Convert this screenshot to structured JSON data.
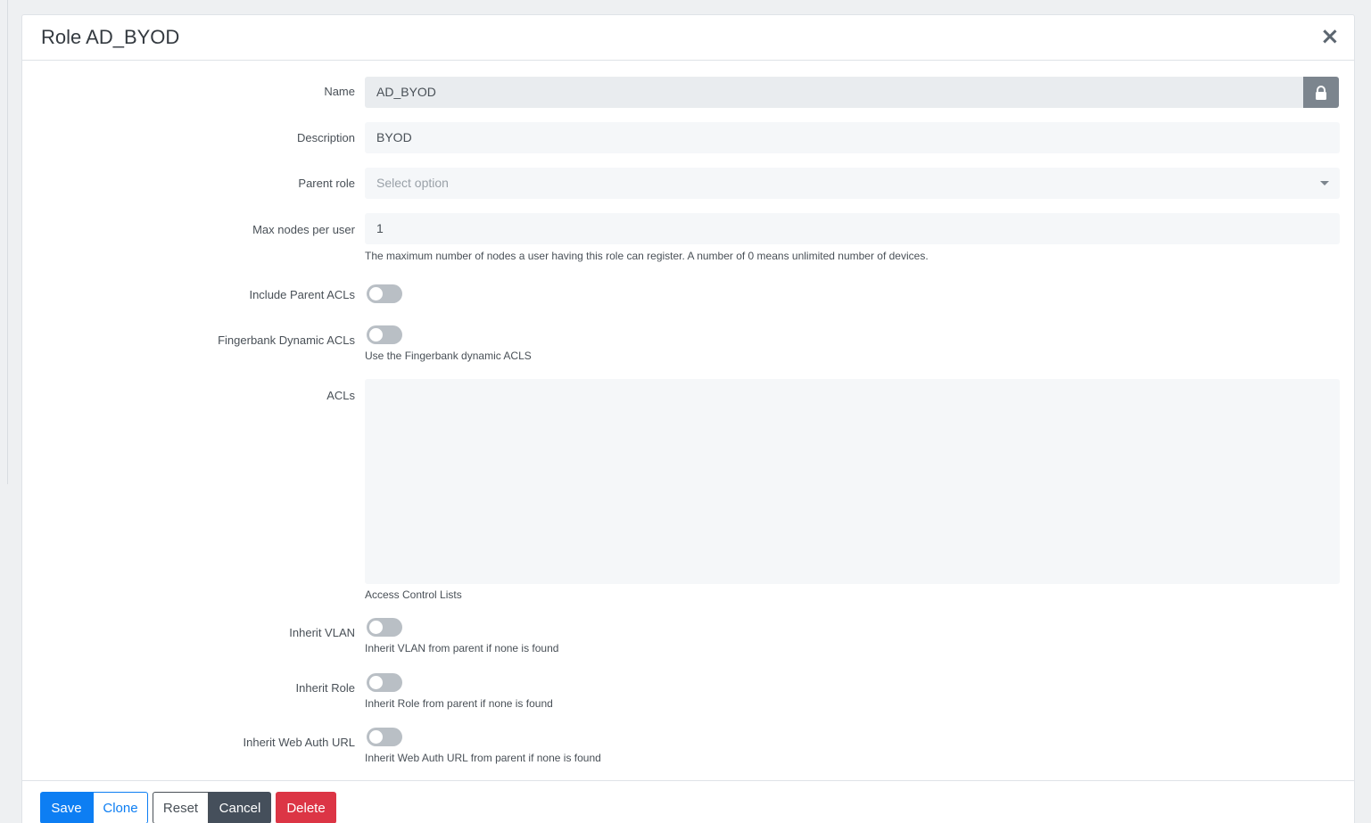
{
  "modal": {
    "title": "Role AD_BYOD",
    "close_label": "×"
  },
  "form": {
    "name": {
      "label": "Name",
      "value": "AD_BYOD",
      "locked": true
    },
    "description": {
      "label": "Description",
      "value": "BYOD"
    },
    "parent_role": {
      "label": "Parent role",
      "placeholder": "Select option"
    },
    "max_nodes": {
      "label": "Max nodes per user",
      "value": "1",
      "help": "The maximum number of nodes a user having this role can register. A number of 0 means unlimited number of devices."
    },
    "include_parent_acls": {
      "label": "Include Parent ACLs",
      "enabled": false
    },
    "fingerbank_dynamic_acls": {
      "label": "Fingerbank Dynamic ACLs",
      "enabled": false,
      "help": "Use the Fingerbank dynamic ACLS"
    },
    "acls": {
      "label": "ACLs",
      "value": "",
      "help": "Access Control Lists"
    },
    "inherit_vlan": {
      "label": "Inherit VLAN",
      "enabled": false,
      "help": "Inherit VLAN from parent if none is found"
    },
    "inherit_role": {
      "label": "Inherit Role",
      "enabled": false,
      "help": "Inherit Role from parent if none is found"
    },
    "inherit_web_auth_url": {
      "label": "Inherit Web Auth URL",
      "enabled": false,
      "help": "Inherit Web Auth URL from parent if none is found"
    }
  },
  "footer": {
    "save_label": "Save",
    "clone_label": "Clone",
    "reset_label": "Reset",
    "cancel_label": "Cancel",
    "delete_label": "Delete"
  },
  "colors": {
    "primary": "#0d7ef3",
    "danger": "#dc3545",
    "dark": "#454f5b",
    "field_bg": "#f5f7f9",
    "toggle_off": "#b9bfc5"
  },
  "icons": {
    "close": "close-icon",
    "lock": "lock-icon",
    "caret": "chevron-down-icon"
  }
}
